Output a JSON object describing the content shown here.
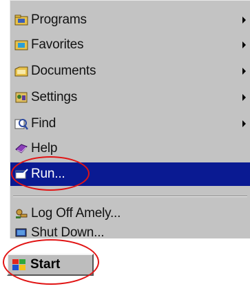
{
  "start_menu": {
    "items": [
      {
        "label": "Programs",
        "has_submenu": true,
        "icon": "programs-folder-icon"
      },
      {
        "label": "Favorites",
        "has_submenu": true,
        "icon": "favorites-folder-icon"
      },
      {
        "label": "Documents",
        "has_submenu": true,
        "icon": "documents-folder-icon"
      },
      {
        "label": "Settings",
        "has_submenu": true,
        "icon": "settings-icon"
      },
      {
        "label": "Find",
        "has_submenu": true,
        "icon": "find-icon"
      },
      {
        "label": "Help",
        "has_submenu": false,
        "icon": "help-book-icon"
      },
      {
        "label": "Run...",
        "has_submenu": false,
        "icon": "run-icon",
        "selected": true
      },
      {
        "label": "Log Off Amely...",
        "has_submenu": false,
        "icon": "log-off-icon"
      },
      {
        "label": "Shut Down...",
        "has_submenu": false,
        "icon": "shut-down-icon"
      }
    ]
  },
  "taskbar": {
    "start_label": "Start"
  },
  "colors": {
    "menu_bg": "#c3c3c3",
    "selection": "#0a1a92",
    "annotation": "#e11414"
  }
}
